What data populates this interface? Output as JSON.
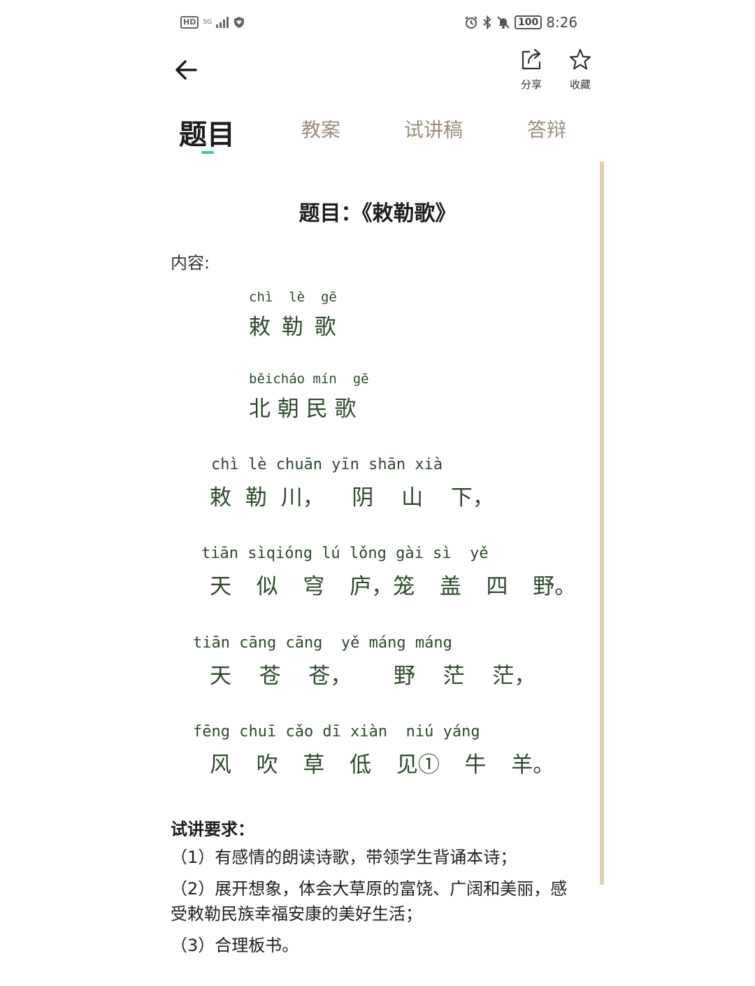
{
  "status_bar": {
    "hd_badge": "HD",
    "signal_label": "5G",
    "battery": "100",
    "time": "8:26"
  },
  "header": {
    "share_label": "分享",
    "favorite_label": "收藏"
  },
  "tabs": [
    {
      "label": "题目",
      "active": true
    },
    {
      "label": "教案",
      "active": false
    },
    {
      "label": "试讲稿",
      "active": false
    },
    {
      "label": "答辩",
      "active": false
    }
  ],
  "content": {
    "title": "题目：《敕勒歌》",
    "content_label": "内容:",
    "poem": [
      {
        "pinyin": "chì  lè  gē",
        "hanzi": "敕 勒 歌"
      },
      {
        "pinyin": "běicháo mín  gē",
        "hanzi": "北 朝 民 歌"
      },
      {
        "pinyin": "chì lè chuān yīn shān xià",
        "hanzi": "敕 勒 川，  阴  山  下，"
      },
      {
        "pinyin": "tiān sìqióng lú lǒng gài sì  yě",
        "hanzi": "天  似  穹  庐，笼  盖  四  野。"
      },
      {
        "pinyin": "tiān cāng cāng  yě máng máng",
        "hanzi": "天  苍  苍，   野  茫  茫，"
      },
      {
        "pinyin": "fēng chuī cǎo dī xiàn  niú yáng",
        "hanzi": "风  吹  草  低  见①  牛  羊。"
      }
    ],
    "requirements_title": "试讲要求：",
    "requirements": [
      "（1）有感情的朗读诗歌，带领学生背诵本诗；",
      "（2）展开想象，体会大草原的富饶、广阔和美丽，感受敕勒民族幸福安康的美好生活；",
      "（3）合理板书。"
    ]
  },
  "colors": {
    "accent": "#3cc9a0",
    "tab_inactive": "#9a8f7c",
    "scrollbar": "#e2cfae",
    "poem_text": "#2d4a2b"
  }
}
